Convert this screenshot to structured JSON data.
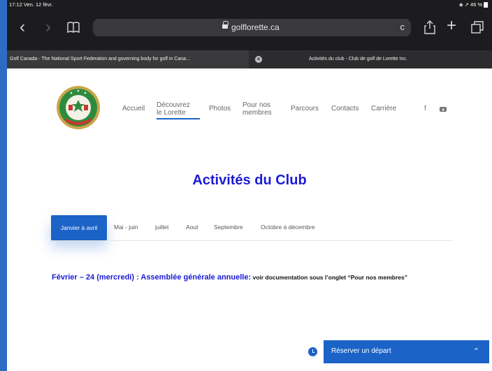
{
  "status": {
    "time": "17:12  Ven. 12 févr.",
    "indicators": "◈ ↗ 46 % ▇"
  },
  "browser": {
    "url_host": "golflorette.ca",
    "tabs": [
      {
        "title": "Golf Canada - The National Sport Federation and governing body for golf in Cana..."
      },
      {
        "title": "Activités du club - Club de golf de Lorette Inc."
      }
    ],
    "icons": {
      "back": "‹",
      "forward": "›",
      "reload": "c",
      "add": "+"
    }
  },
  "site": {
    "logo_text_top": "CLUB DE GOLF",
    "logo_text_bottom": "LORETTE",
    "nav": [
      {
        "label": "Accueil"
      },
      {
        "label": "Découvrez\nle Lorette"
      },
      {
        "label": "Photos"
      },
      {
        "label": "Pour nos\nmembres"
      },
      {
        "label": "Parcours"
      },
      {
        "label": "Contacts"
      },
      {
        "label": "Carrière"
      }
    ],
    "social": {
      "facebook": "f"
    }
  },
  "main": {
    "title": "Activités du Club",
    "tabs": [
      {
        "label": "Janvier à avril",
        "active": true
      },
      {
        "label": "Mai - juin"
      },
      {
        "label": "juillet"
      },
      {
        "label": "Aout"
      },
      {
        "label": "Septembre"
      },
      {
        "label": "Octobre à décembre"
      }
    ],
    "event": {
      "headline": "Février – 24 (mercredi) : Assemblée générale annuelle:",
      "detail": " voir documentation sous l’onglet “Pour nos membres”"
    }
  },
  "reserve": {
    "label": "Réserver un départ",
    "chevron": "⌃"
  },
  "colors": {
    "accent": "#1b63c6",
    "title": "#1b1bd6",
    "frame": "#1c1c1e"
  }
}
